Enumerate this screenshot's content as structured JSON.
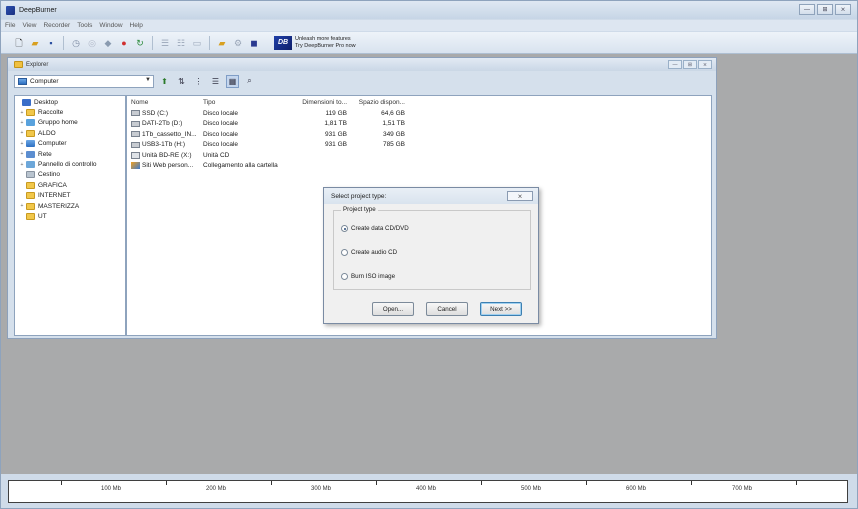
{
  "app": {
    "title": "DeepBurner"
  },
  "window_controls": {
    "minimize": "—",
    "maximize": "⊞",
    "close": "⨯"
  },
  "menu": [
    "File",
    "View",
    "Recorder",
    "Tools",
    "Window",
    "Help"
  ],
  "promo": {
    "logo": "DB",
    "line1": "Unleash more features",
    "line2": "Try DeepBurner Pro now"
  },
  "explorer": {
    "title": "Explorer",
    "location": "Computer",
    "tree": [
      {
        "label": "Desktop",
        "icon": "desktop-icon",
        "expander": ""
      },
      {
        "label": "Raccolte",
        "icon": "folder-icon",
        "expander": "+"
      },
      {
        "label": "Gruppo home",
        "icon": "homegroup-icon",
        "expander": "+"
      },
      {
        "label": "ALDO",
        "icon": "folder-icon",
        "expander": "+"
      },
      {
        "label": "Computer",
        "icon": "computer-icon",
        "expander": "+"
      },
      {
        "label": "Rete",
        "icon": "network-icon",
        "expander": "+"
      },
      {
        "label": "Pannello di controllo",
        "icon": "control-panel-icon",
        "expander": "+"
      },
      {
        "label": "Cestino",
        "icon": "recycle-bin-icon",
        "expander": ""
      },
      {
        "label": "GRAFICA",
        "icon": "folder-icon",
        "expander": ""
      },
      {
        "label": "INTERNET",
        "icon": "folder-icon",
        "expander": ""
      },
      {
        "label": "MASTERIZZA",
        "icon": "folder-icon",
        "expander": "+"
      },
      {
        "label": "UT",
        "icon": "folder-icon",
        "expander": ""
      }
    ],
    "columns": {
      "name": "Nome",
      "type": "Tipo",
      "size": "Dimensioni to...",
      "free": "Spazio dispon..."
    },
    "files": [
      {
        "name": "SSD (C:)",
        "type": "Disco locale",
        "size": "119 GB",
        "free": "64,6 GB",
        "icon": "drive-icon"
      },
      {
        "name": "DATI-2Tb (D:)",
        "type": "Disco locale",
        "size": "1,81 TB",
        "free": "1,51 TB",
        "icon": "drive-icon"
      },
      {
        "name": "1Tb_cassetto_IN...",
        "type": "Disco locale",
        "size": "931 GB",
        "free": "349 GB",
        "icon": "drive-icon"
      },
      {
        "name": "USB3-1Tb (H:)",
        "type": "Disco locale",
        "size": "931 GB",
        "free": "785 GB",
        "icon": "drive-icon"
      },
      {
        "name": "Unità BD-RE (X:)",
        "type": "Unità CD",
        "size": "",
        "free": "",
        "icon": "cd-drive-icon"
      },
      {
        "name": "Siti Web person...",
        "type": "Collegamento alla cartella",
        "size": "",
        "free": "",
        "icon": "web-folder-icon"
      }
    ]
  },
  "dialog": {
    "title": "Select project type:",
    "close": "⨯",
    "group_label": "Project type",
    "options": [
      {
        "label": "Create data CD/DVD",
        "checked": true
      },
      {
        "label": "Create audio CD",
        "checked": false
      },
      {
        "label": "Burn ISO image",
        "checked": false
      }
    ],
    "buttons": {
      "open": "Open...",
      "cancel": "Cancel",
      "next": "Next >>"
    }
  },
  "ruler": {
    "labels": [
      "100 Mb",
      "200 Mb",
      "300 Mb",
      "400 Mb",
      "500 Mb",
      "600 Mb",
      "700 Mb"
    ]
  }
}
